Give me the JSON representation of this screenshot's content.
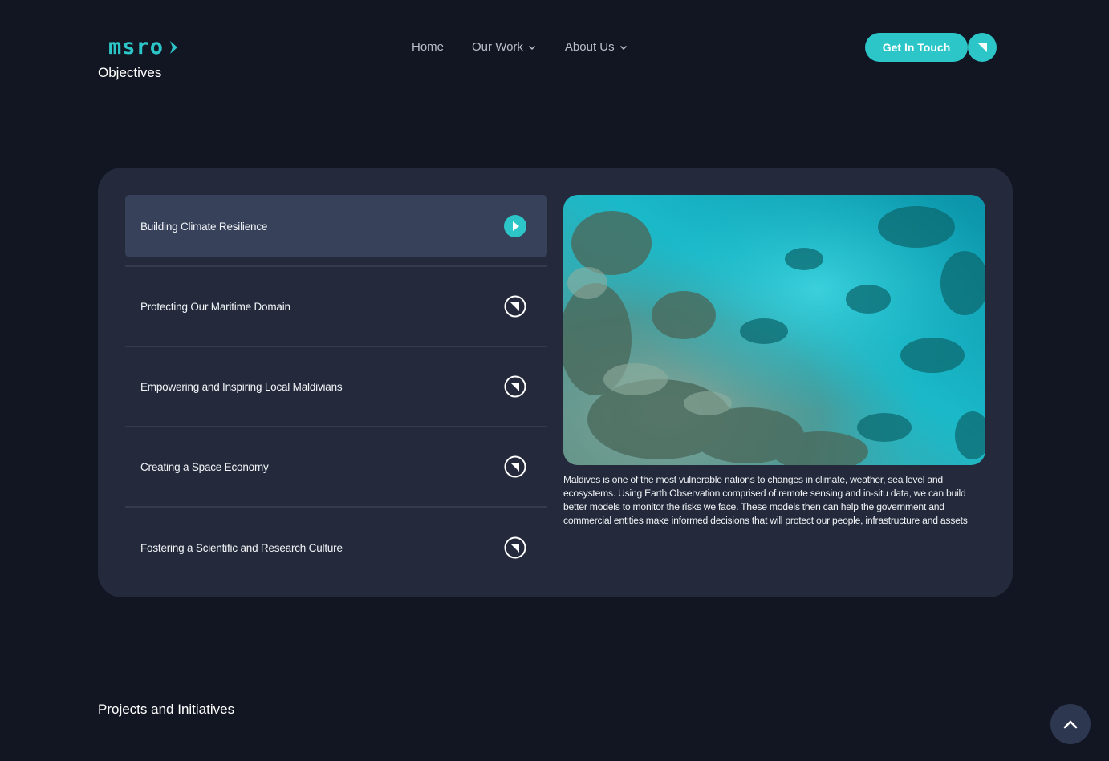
{
  "header": {
    "logo_text": "msro",
    "nav": [
      {
        "label": "Home"
      },
      {
        "label": "Our Work"
      },
      {
        "label": "About Us"
      }
    ],
    "cta_label": "Get In Touch"
  },
  "objectives": {
    "title": "Objectives",
    "items": [
      {
        "label": "Building Climate Resilience",
        "active": true
      },
      {
        "label": "Protecting Our Maritime Domain",
        "active": false
      },
      {
        "label": "Empowering and Inspiring Local Maldivians",
        "active": false
      },
      {
        "label": "Creating a Space Economy",
        "active": false
      },
      {
        "label": "Fostering a Scientific and Research Culture",
        "active": false
      }
    ],
    "description": "Maldives is one of the most vulnerable nations to changes in climate, weather, sea level and ecosystems. Using Earth Observation comprised of remote sensing and in-situ data, we can build better models to monitor the risks we face. These models then can help the government and commercial entities make informed decisions that will protect our people, infrastructure and assets"
  },
  "projects": {
    "title": "Projects and Initiatives"
  },
  "colors": {
    "background": "#121622",
    "card": "#242a3b",
    "accent": "#2cc6c8",
    "active_item": "#37425a"
  },
  "icons": {
    "logo_arrow": "logo-arrow-icon",
    "cta": "arrow-down-right-icon",
    "active_item": "play-icon",
    "item": "arrow-down-right-circle-icon",
    "scroll_top": "chevron-up-icon"
  }
}
